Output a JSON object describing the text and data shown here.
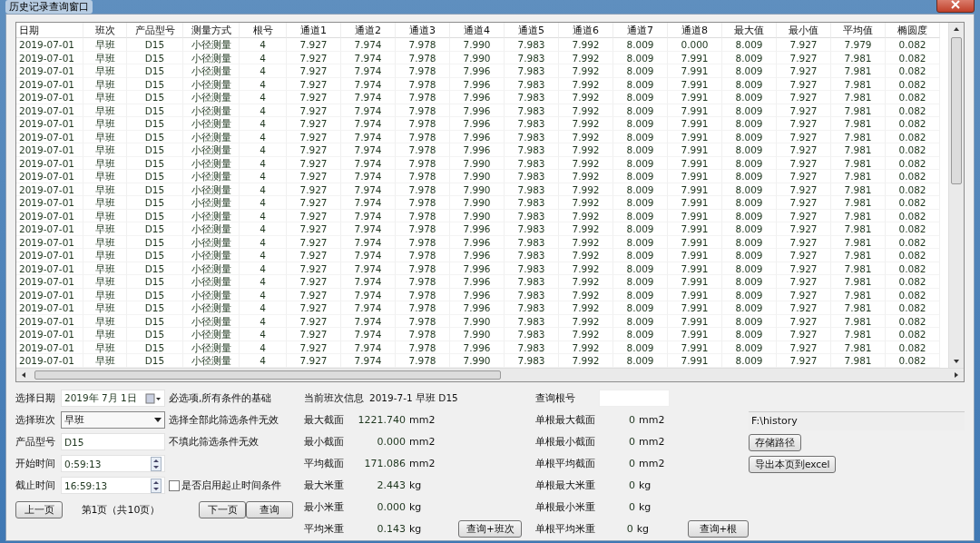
{
  "window": {
    "title": "历史记录查询窗口"
  },
  "table": {
    "columns": [
      "日期",
      "班次",
      "产品型号",
      "测量方式",
      "根号",
      "通道1",
      "通道2",
      "通道3",
      "通道4",
      "通道5",
      "通道6",
      "通道7",
      "通道8",
      "最大值",
      "最小值",
      "平均值",
      "椭圆度"
    ],
    "rows": [
      [
        "2019-07-01",
        "早班",
        "D15",
        "小径测量",
        "4",
        "7.927",
        "7.974",
        "7.978",
        "7.990",
        "7.983",
        "7.992",
        "8.009",
        "0.000",
        "8.009",
        "7.927",
        "7.979",
        "0.082"
      ],
      [
        "2019-07-01",
        "早班",
        "D15",
        "小径测量",
        "4",
        "7.927",
        "7.974",
        "7.978",
        "7.990",
        "7.983",
        "7.992",
        "8.009",
        "7.991",
        "8.009",
        "7.927",
        "7.981",
        "0.082"
      ],
      [
        "2019-07-01",
        "早班",
        "D15",
        "小径测量",
        "4",
        "7.927",
        "7.974",
        "7.978",
        "7.996",
        "7.983",
        "7.992",
        "8.009",
        "7.991",
        "8.009",
        "7.927",
        "7.981",
        "0.082"
      ],
      [
        "2019-07-01",
        "早班",
        "D15",
        "小径测量",
        "4",
        "7.927",
        "7.974",
        "7.978",
        "7.996",
        "7.983",
        "7.992",
        "8.009",
        "7.991",
        "8.009",
        "7.927",
        "7.981",
        "0.082"
      ],
      [
        "2019-07-01",
        "早班",
        "D15",
        "小径测量",
        "4",
        "7.927",
        "7.974",
        "7.978",
        "7.996",
        "7.983",
        "7.992",
        "8.009",
        "7.991",
        "8.009",
        "7.927",
        "7.981",
        "0.082"
      ],
      [
        "2019-07-01",
        "早班",
        "D15",
        "小径测量",
        "4",
        "7.927",
        "7.974",
        "7.978",
        "7.996",
        "7.983",
        "7.992",
        "8.009",
        "7.991",
        "8.009",
        "7.927",
        "7.981",
        "0.082"
      ],
      [
        "2019-07-01",
        "早班",
        "D15",
        "小径测量",
        "4",
        "7.927",
        "7.974",
        "7.978",
        "7.996",
        "7.983",
        "7.992",
        "8.009",
        "7.991",
        "8.009",
        "7.927",
        "7.981",
        "0.082"
      ],
      [
        "2019-07-01",
        "早班",
        "D15",
        "小径测量",
        "4",
        "7.927",
        "7.974",
        "7.978",
        "7.996",
        "7.983",
        "7.992",
        "8.009",
        "7.991",
        "8.009",
        "7.927",
        "7.981",
        "0.082"
      ],
      [
        "2019-07-01",
        "早班",
        "D15",
        "小径测量",
        "4",
        "7.927",
        "7.974",
        "7.978",
        "7.996",
        "7.983",
        "7.992",
        "8.009",
        "7.991",
        "8.009",
        "7.927",
        "7.981",
        "0.082"
      ],
      [
        "2019-07-01",
        "早班",
        "D15",
        "小径测量",
        "4",
        "7.927",
        "7.974",
        "7.978",
        "7.990",
        "7.983",
        "7.992",
        "8.009",
        "7.991",
        "8.009",
        "7.927",
        "7.981",
        "0.082"
      ],
      [
        "2019-07-01",
        "早班",
        "D15",
        "小径测量",
        "4",
        "7.927",
        "7.974",
        "7.978",
        "7.990",
        "7.983",
        "7.992",
        "8.009",
        "7.991",
        "8.009",
        "7.927",
        "7.981",
        "0.082"
      ],
      [
        "2019-07-01",
        "早班",
        "D15",
        "小径测量",
        "4",
        "7.927",
        "7.974",
        "7.978",
        "7.990",
        "7.983",
        "7.992",
        "8.009",
        "7.991",
        "8.009",
        "7.927",
        "7.981",
        "0.082"
      ],
      [
        "2019-07-01",
        "早班",
        "D15",
        "小径测量",
        "4",
        "7.927",
        "7.974",
        "7.978",
        "7.990",
        "7.983",
        "7.992",
        "8.009",
        "7.991",
        "8.009",
        "7.927",
        "7.981",
        "0.082"
      ],
      [
        "2019-07-01",
        "早班",
        "D15",
        "小径测量",
        "4",
        "7.927",
        "7.974",
        "7.978",
        "7.990",
        "7.983",
        "7.992",
        "8.009",
        "7.991",
        "8.009",
        "7.927",
        "7.981",
        "0.082"
      ],
      [
        "2019-07-01",
        "早班",
        "D15",
        "小径测量",
        "4",
        "7.927",
        "7.974",
        "7.978",
        "7.996",
        "7.983",
        "7.992",
        "8.009",
        "7.991",
        "8.009",
        "7.927",
        "7.981",
        "0.082"
      ],
      [
        "2019-07-01",
        "早班",
        "D15",
        "小径测量",
        "4",
        "7.927",
        "7.974",
        "7.978",
        "7.996",
        "7.983",
        "7.992",
        "8.009",
        "7.991",
        "8.009",
        "7.927",
        "7.981",
        "0.082"
      ],
      [
        "2019-07-01",
        "早班",
        "D15",
        "小径测量",
        "4",
        "7.927",
        "7.974",
        "7.978",
        "7.996",
        "7.983",
        "7.992",
        "8.009",
        "7.991",
        "8.009",
        "7.927",
        "7.981",
        "0.082"
      ],
      [
        "2019-07-01",
        "早班",
        "D15",
        "小径测量",
        "4",
        "7.927",
        "7.974",
        "7.978",
        "7.996",
        "7.983",
        "7.992",
        "8.009",
        "7.991",
        "8.009",
        "7.927",
        "7.981",
        "0.082"
      ],
      [
        "2019-07-01",
        "早班",
        "D15",
        "小径测量",
        "4",
        "7.927",
        "7.974",
        "7.978",
        "7.996",
        "7.983",
        "7.992",
        "8.009",
        "7.991",
        "8.009",
        "7.927",
        "7.981",
        "0.082"
      ],
      [
        "2019-07-01",
        "早班",
        "D15",
        "小径测量",
        "4",
        "7.927",
        "7.974",
        "7.978",
        "7.996",
        "7.983",
        "7.992",
        "8.009",
        "7.991",
        "8.009",
        "7.927",
        "7.981",
        "0.082"
      ],
      [
        "2019-07-01",
        "早班",
        "D15",
        "小径测量",
        "4",
        "7.927",
        "7.974",
        "7.978",
        "7.996",
        "7.983",
        "7.992",
        "8.009",
        "7.991",
        "8.009",
        "7.927",
        "7.981",
        "0.082"
      ],
      [
        "2019-07-01",
        "早班",
        "D15",
        "小径测量",
        "4",
        "7.927",
        "7.974",
        "7.978",
        "7.990",
        "7.983",
        "7.992",
        "8.009",
        "7.991",
        "8.009",
        "7.927",
        "7.981",
        "0.082"
      ],
      [
        "2019-07-01",
        "早班",
        "D15",
        "小径测量",
        "4",
        "7.927",
        "7.974",
        "7.978",
        "7.990",
        "7.983",
        "7.992",
        "8.009",
        "7.991",
        "8.009",
        "7.927",
        "7.981",
        "0.082"
      ],
      [
        "2019-07-01",
        "早班",
        "D15",
        "小径测量",
        "4",
        "7.927",
        "7.974",
        "7.978",
        "7.996",
        "7.983",
        "7.992",
        "8.009",
        "7.991",
        "8.009",
        "7.927",
        "7.981",
        "0.082"
      ],
      [
        "2019-07-01",
        "早班",
        "D15",
        "小径测量",
        "4",
        "7.927",
        "7.974",
        "7.978",
        "7.990",
        "7.983",
        "7.992",
        "8.009",
        "7.991",
        "8.009",
        "7.927",
        "7.981",
        "0.082"
      ]
    ]
  },
  "filters": {
    "date": {
      "label": "选择日期",
      "value": "2019年  7月  1日",
      "hint": "必选项,所有条件的基础"
    },
    "shift": {
      "label": "选择班次",
      "value": "早班",
      "hint": "选择全部此筛选条件无效"
    },
    "product": {
      "label": "产品型号",
      "value": "D15",
      "hint": "不填此筛选条件无效"
    },
    "start_time": {
      "label": "开始时间",
      "value": "0:59:13"
    },
    "end_time": {
      "label": "截止时间",
      "value": "16:59:13"
    },
    "time_condition": {
      "label": "是否启用起止时间条件",
      "checked": false
    }
  },
  "pager": {
    "prev": "上一页",
    "page_info": "第1页（共10页）",
    "next": "下一页",
    "query": "查询"
  },
  "shift_info": {
    "label": "当前班次信息",
    "value": "2019-7-1 早班 D15"
  },
  "shift_stats": [
    {
      "label": "最大截面",
      "value": "1221.740",
      "unit": "mm2"
    },
    {
      "label": "最小截面",
      "value": "0.000",
      "unit": "mm2"
    },
    {
      "label": "平均截面",
      "value": "171.086",
      "unit": "mm2"
    },
    {
      "label": "最大米重",
      "value": "2.443",
      "unit": "kg"
    },
    {
      "label": "最小米重",
      "value": "0.000",
      "unit": "kg"
    },
    {
      "label": "平均米重",
      "value": "0.143",
      "unit": "kg"
    }
  ],
  "shift_query_button": "查询+班次",
  "root_query": {
    "label": "查询根号"
  },
  "root_stats": [
    {
      "label": "单根最大截面",
      "value": "0",
      "unit": "mm2"
    },
    {
      "label": "单根最小截面",
      "value": "0",
      "unit": "mm2"
    },
    {
      "label": "单根平均截面",
      "value": "0",
      "unit": "mm2"
    },
    {
      "label": "单根最大米重",
      "value": "0",
      "unit": "kg"
    },
    {
      "label": "单根最小米重",
      "value": "0",
      "unit": "kg"
    },
    {
      "label": "单根平均米重",
      "value": "0",
      "unit": "kg"
    }
  ],
  "root_query_button": "查询+根",
  "storage": {
    "path": "F:\\history",
    "path_button": "存储路径",
    "export_button": "导出本页到excel"
  }
}
